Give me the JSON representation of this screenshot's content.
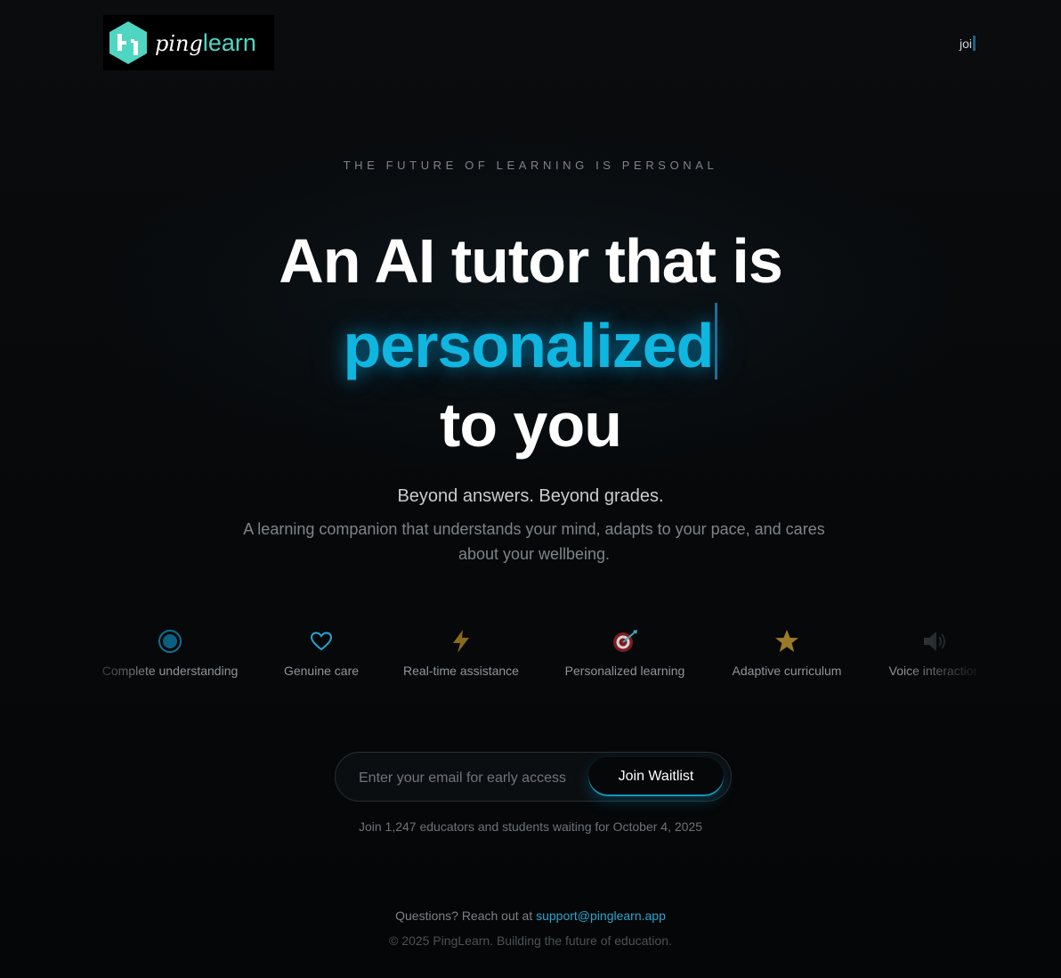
{
  "brand": {
    "name_part1": "ping",
    "name_part2": "learn",
    "colors": {
      "accent": "#0fb6e0",
      "logo_teal": "#4fd6c2",
      "background": "#060708"
    }
  },
  "nav": {
    "typing_text": "joi"
  },
  "hero": {
    "eyebrow": "THE FUTURE OF LEARNING IS PERSONAL",
    "headline_line1": "An AI tutor that is",
    "headline_highlight": "personalized",
    "headline_line3": "to you",
    "subheadline": "Beyond answers. Beyond grades.",
    "description": "A learning companion that understands your mind, adapts to your pace, and cares about your wellbeing."
  },
  "features": [
    {
      "icon": "target-dot-icon",
      "label": "Complete understanding"
    },
    {
      "icon": "heart-icon",
      "label": "Genuine care"
    },
    {
      "icon": "lightning-icon",
      "label": "Real-time assistance"
    },
    {
      "icon": "dart-target-icon",
      "label": "Personalized learning"
    },
    {
      "icon": "star-icon",
      "label": "Adaptive curriculum"
    },
    {
      "icon": "speaker-icon",
      "label": "Voice interaction"
    }
  ],
  "waitlist": {
    "email_placeholder": "Enter your email for early access",
    "email_value": "",
    "button_label": "Join Waitlist",
    "note": "Join 1,247 educators and students waiting for October 4, 2025"
  },
  "footer": {
    "contact_prefix": "Questions? Reach out at",
    "contact_email": "support@pinglearn.app",
    "copyright": "© 2025 PingLearn. Building the future of education."
  }
}
